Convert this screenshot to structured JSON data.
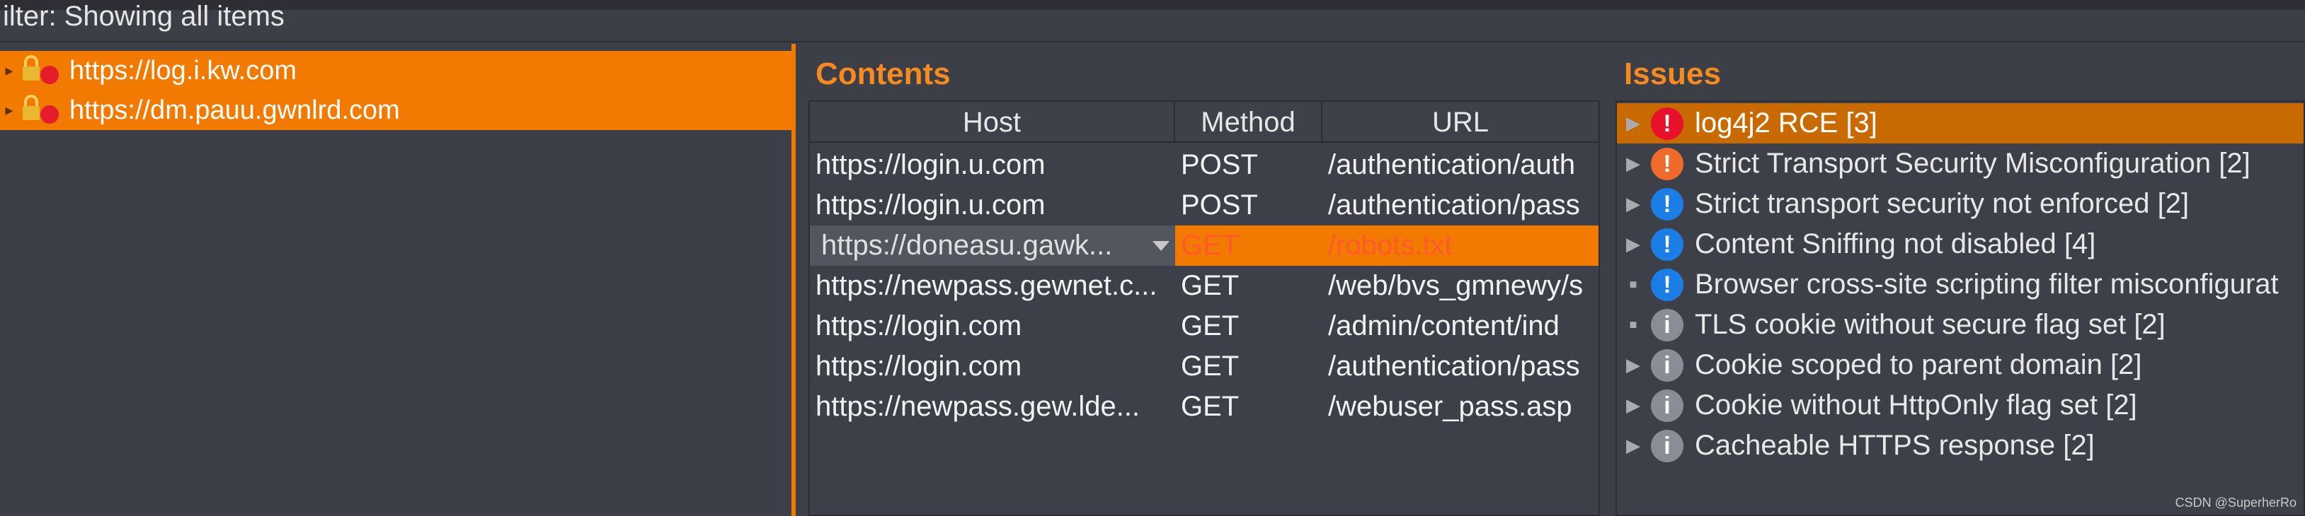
{
  "filter": {
    "text": "ilter: Showing all items"
  },
  "site_tree": {
    "items": [
      {
        "label": "https://log.i.kw.com",
        "selected": true
      },
      {
        "label": "https://dm.pauu.gwnlrd.com",
        "selected": true
      }
    ]
  },
  "contents": {
    "title": "Contents",
    "columns": [
      "Host",
      "Method",
      "URL"
    ],
    "rows": [
      {
        "host": "https://login.u.com",
        "method": "POST",
        "url": "/authentication/auth",
        "selected": false
      },
      {
        "host": "https://login.u.com",
        "method": "POST",
        "url": "/authentication/pass",
        "selected": false
      },
      {
        "host": "https://doneasu.gawk...",
        "method": "GET",
        "url": "/robots.txt",
        "selected": true
      },
      {
        "host": "https://newpass.gewnet.c...",
        "method": "GET",
        "url": "/web/bvs_gmnewy/s",
        "selected": false
      },
      {
        "host": "https://login.com",
        "method": "GET",
        "url": "/admin/content/ind",
        "selected": false
      },
      {
        "host": "https://login.com",
        "method": "GET",
        "url": "/authentication/pass",
        "selected": false
      },
      {
        "host": "https://newpass.gew.lde...",
        "method": "GET",
        "url": "/webuser_pass.asp",
        "selected": false
      }
    ]
  },
  "issues": {
    "title": "Issues",
    "colors": {
      "high": "#e8102a",
      "medium": "#f06a2a",
      "low": "#1a7ee6",
      "info": "#8a8d95",
      "accent": "#f27a00"
    },
    "items": [
      {
        "label": "log4j2 RCE [3]",
        "severity": "high",
        "glyph": "!",
        "expander": "▶",
        "selected": true
      },
      {
        "label": "Strict Transport Security Misconfiguration [2]",
        "severity": "medium",
        "glyph": "!",
        "expander": "▶",
        "selected": false
      },
      {
        "label": "Strict transport security not enforced [2]",
        "severity": "low",
        "glyph": "!",
        "expander": "▶",
        "selected": false
      },
      {
        "label": "Content Sniffing not disabled [4]",
        "severity": "low",
        "glyph": "!",
        "expander": "▶",
        "selected": false
      },
      {
        "label": "Browser cross-site scripting filter misconfigurat",
        "severity": "low",
        "glyph": "!",
        "expander": "■",
        "selected": false
      },
      {
        "label": "TLS cookie without secure flag set [2]",
        "severity": "info",
        "glyph": "i",
        "expander": "■",
        "selected": false
      },
      {
        "label": "Cookie scoped to parent domain [2]",
        "severity": "info",
        "glyph": "i",
        "expander": "▶",
        "selected": false
      },
      {
        "label": "Cookie without HttpOnly flag set [2]",
        "severity": "info",
        "glyph": "i",
        "expander": "▶",
        "selected": false
      },
      {
        "label": "Cacheable HTTPS response [2]",
        "severity": "info",
        "glyph": "i",
        "expander": "▶",
        "selected": false
      }
    ]
  },
  "watermark": "CSDN @SuperherRo"
}
